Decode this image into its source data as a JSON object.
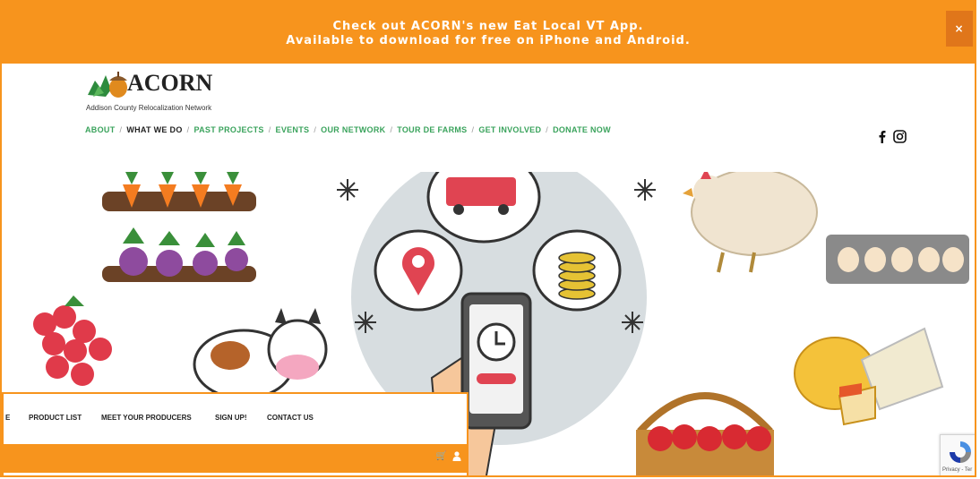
{
  "banner": {
    "line1": "Check out ACORN's new Eat Local VT App.",
    "line2": "Available to download for free on iPhone and Android.",
    "close_label": "×"
  },
  "logo": {
    "title": "ACORN",
    "subtitle": "Addison County Relocalization Network"
  },
  "nav": {
    "items": [
      {
        "label": "ABOUT"
      },
      {
        "label": "WHAT WE DO"
      },
      {
        "label": "PAST PROJECTS"
      },
      {
        "label": "EVENTS"
      },
      {
        "label": "OUR NETWORK"
      },
      {
        "label": "TOUR DE FARMS"
      },
      {
        "label": "GET INVOLVED"
      },
      {
        "label": "DONATE NOW"
      }
    ],
    "separator": "/"
  },
  "lower_nav": {
    "items": [
      {
        "label": "E"
      },
      {
        "label": "PRODUCT LIST"
      },
      {
        "label": "MEET YOUR PRODUCERS"
      },
      {
        "label": "SIGN UP!"
      },
      {
        "label": "CONTACT US"
      }
    ],
    "cart_icon": "cart-icon",
    "user_icon": "user-icon",
    "cart_glyph": "🛒"
  },
  "recaptcha": {
    "text": "Privacy - Ter"
  },
  "colors": {
    "brand_orange": "#f7941d",
    "nav_green": "#3aa35c"
  }
}
